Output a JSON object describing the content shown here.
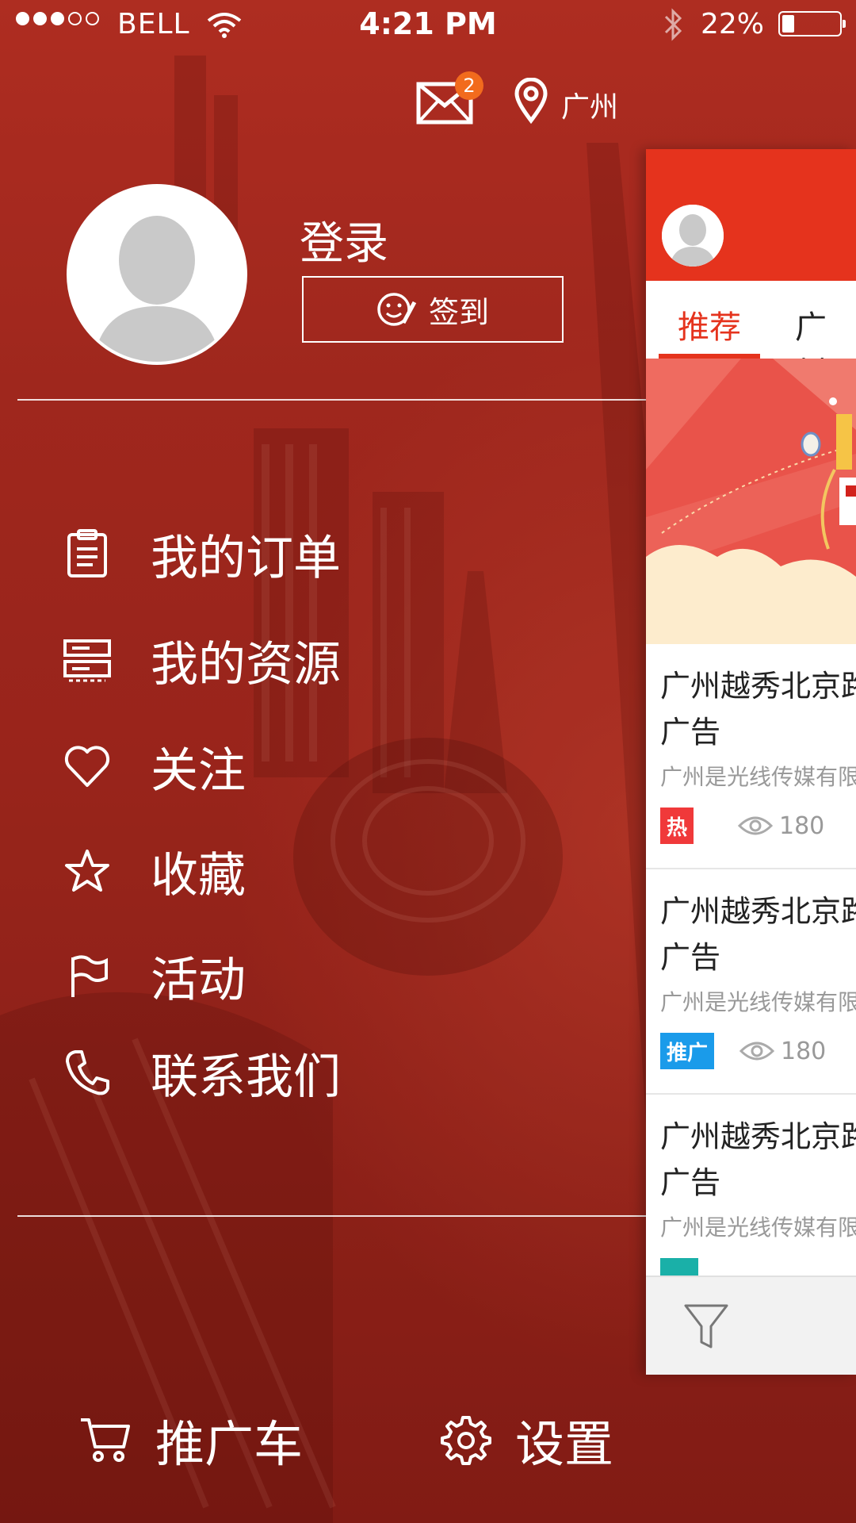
{
  "status_bar": {
    "carrier": "BELL",
    "time": "4:21 PM",
    "battery_pct": "22%",
    "battery_level": 0.22,
    "signal_bars_filled": 3,
    "signal_bars_total": 5
  },
  "header": {
    "message_badge": "2",
    "location": "广州"
  },
  "profile": {
    "login_label": "登录",
    "checkin_label": "签到"
  },
  "menu": {
    "items": [
      {
        "label": "我的订单",
        "icon": "clipboard-icon"
      },
      {
        "label": "我的资源",
        "icon": "server-icon"
      },
      {
        "label": "关注",
        "icon": "heart-icon"
      },
      {
        "label": "收藏",
        "icon": "star-icon"
      },
      {
        "label": "活动",
        "icon": "flag-icon"
      },
      {
        "label": "联系我们",
        "icon": "phone-icon"
      }
    ]
  },
  "bottom": {
    "cart_label": "推广车",
    "settings_label": "设置"
  },
  "panel": {
    "tabs": [
      "推荐",
      "广州"
    ],
    "active_tab": "推荐",
    "news": [
      {
        "title_line1": "广州越秀北京路",
        "title_line2": "广告",
        "desc": "广州是光线传媒有限",
        "tag": "热",
        "tag_color": "#f0393a",
        "views": "180"
      },
      {
        "title_line1": "广州越秀北京路",
        "title_line2": "广告",
        "desc": "广州是光线传媒有限",
        "tag": "推广",
        "tag_color": "#1a9bea",
        "views": "180"
      },
      {
        "title_line1": "广州越秀北京路",
        "title_line2": "广告",
        "desc": "广州是光线传媒有限",
        "tag": "",
        "tag_color": "#1ab0a8",
        "views": ""
      }
    ]
  },
  "colors": {
    "brand_red": "#e5331d",
    "badge_orange": "#f26b1d"
  }
}
